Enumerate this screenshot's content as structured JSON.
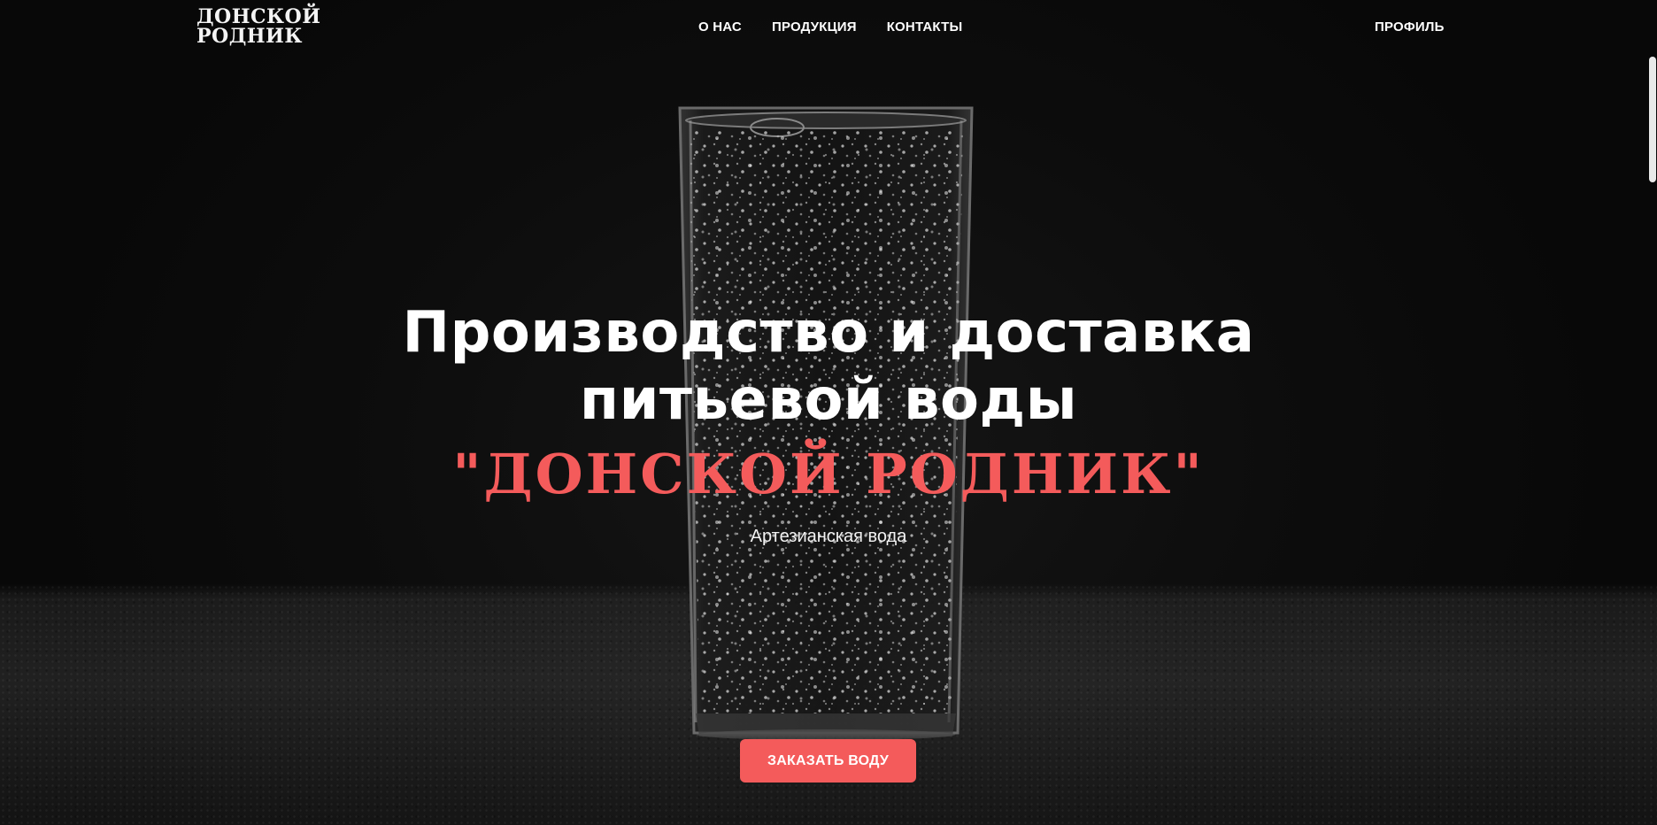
{
  "header": {
    "logo_line1": "Донской",
    "logo_line2": "Родник",
    "nav": [
      "О нас",
      "Продукция",
      "Контакты"
    ],
    "profile_label": "Профиль"
  },
  "hero": {
    "title_line1": "Производство и доставка",
    "title_line2": "питьевой воды",
    "brand": "\"Донской Родник\"",
    "subtitle": "Артезианская вода",
    "cta_label": "Заказать воду"
  },
  "colors": {
    "background": "#0b0b0b",
    "accent": "#f45b5b",
    "text": "#ffffff"
  },
  "background_image": "glass-of-sparkling-water-icon"
}
